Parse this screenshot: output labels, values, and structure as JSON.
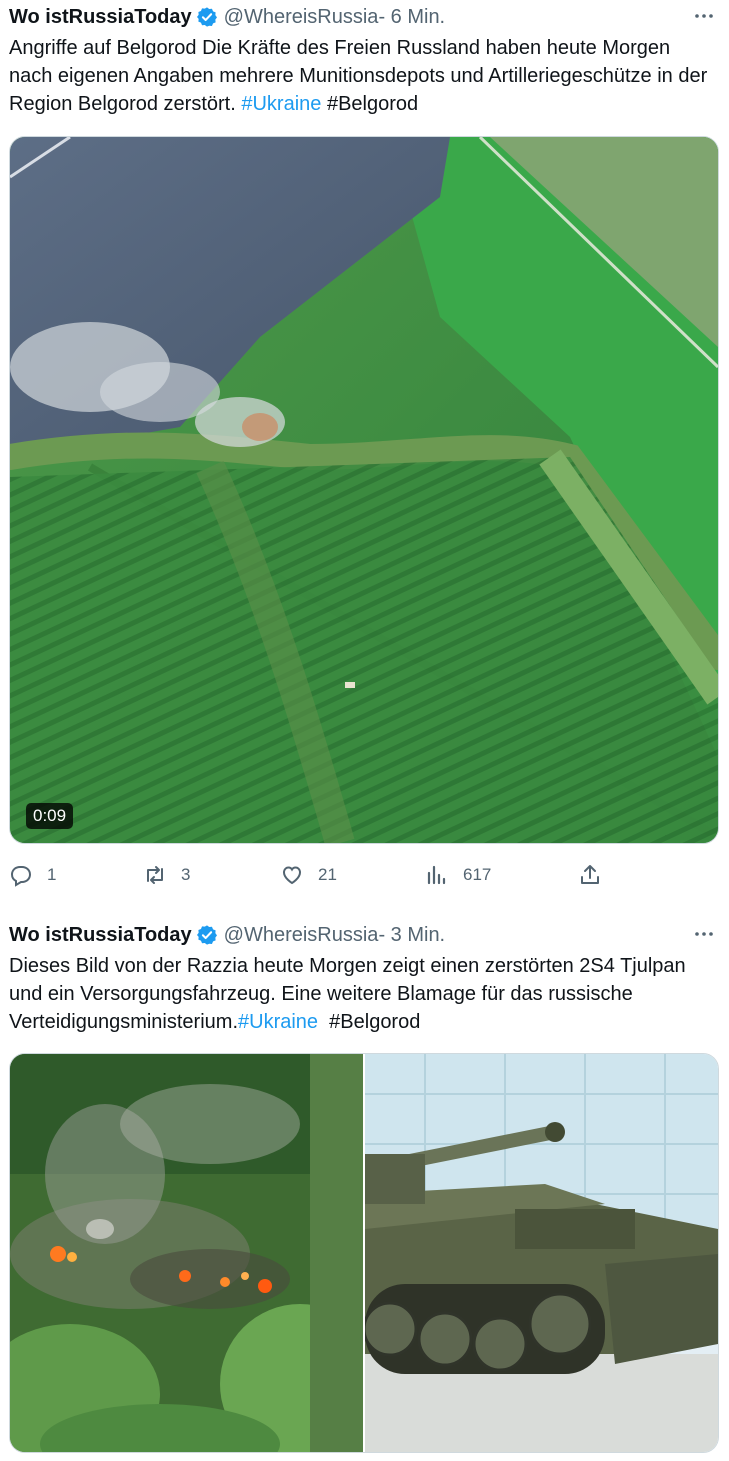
{
  "tweets": [
    {
      "author_name": "Wo istRussiaToday",
      "handle": "@WhereisRussia",
      "time": " - 6 Min.",
      "text_parts": {
        "main": "Angriffe auf Belgorod Die Kräfte des Freien Russland haben heute Morgen nach eigenen Angaben mehrere Munitionsdepots und Artilleriegeschütze in der Region Belgorod zerstört. ",
        "hashtag_link": "#Ukraine",
        "hashtag_plain": " #Belgorod"
      },
      "video_duration": "0:09",
      "stats": {
        "replies": "1",
        "retweets": "3",
        "likes": "21",
        "views": "617"
      }
    },
    {
      "author_name": "Wo istRussiaToday",
      "handle": "@WhereisRussia",
      "time": " - 3 Min.",
      "text_parts": {
        "main": "Dieses Bild von der Razzia heute Morgen zeigt einen zerstörten 2S4 Tjulpan und ein Versorgungsfahrzeug. Eine weitere Blamage für das russische Verteidigungsministerium.",
        "hashtag_link": "#Ukraine",
        "hashtag_plain": "  #Belgorod"
      }
    }
  ],
  "colors": {
    "link": "#1d9bf0",
    "secondary_text": "#536471",
    "verified_badge": "#1d9bf0"
  },
  "icons": {
    "verified": "verified-badge-icon",
    "more": "more-dots-icon",
    "reply": "reply-icon",
    "retweet": "retweet-icon",
    "like": "heart-icon",
    "views": "views-icon",
    "share": "share-icon"
  }
}
